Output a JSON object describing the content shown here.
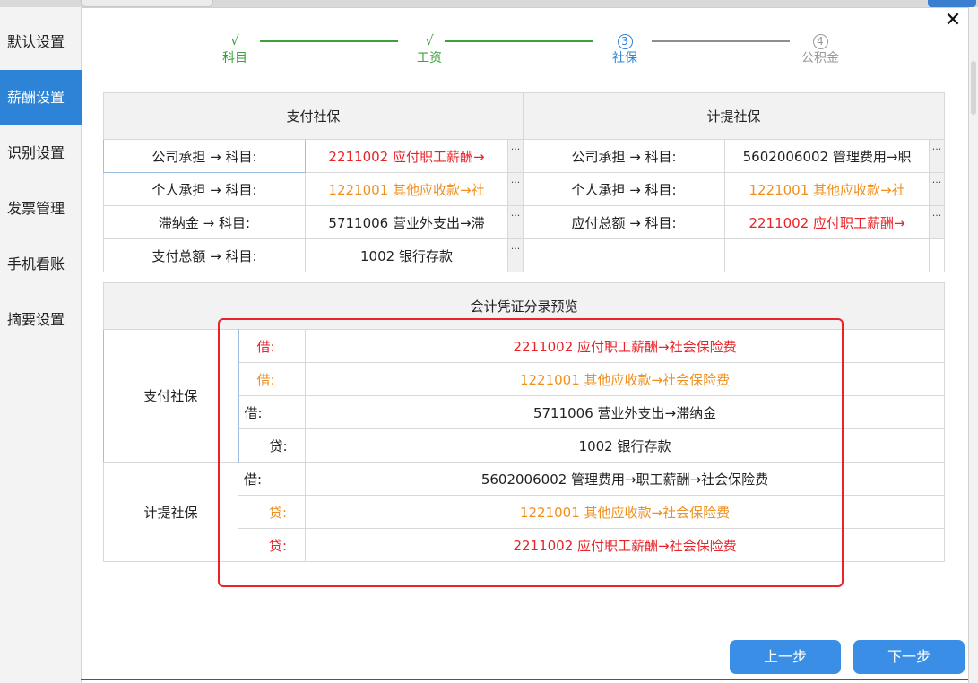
{
  "sidebar": {
    "items": [
      {
        "label": "默认设置"
      },
      {
        "label": "薪酬设置"
      },
      {
        "label": "识别设置"
      },
      {
        "label": "发票管理"
      },
      {
        "label": "手机看账"
      },
      {
        "label": "摘要设置"
      }
    ],
    "active_index": 1
  },
  "dialog": {
    "close_label": "✕"
  },
  "stepper": {
    "steps": [
      {
        "mark": "√",
        "label": "科目",
        "state": "done"
      },
      {
        "mark": "√",
        "label": "工资",
        "state": "done"
      },
      {
        "mark": "3",
        "label": "社保",
        "state": "current"
      },
      {
        "mark": "4",
        "label": "公积金",
        "state": "todo"
      }
    ]
  },
  "mapping": {
    "pay_header": "支付社保",
    "accrue_header": "计提社保",
    "pay_rows": [
      {
        "label": "公司承担 → 科目:",
        "value": "2211002 应付职工薪酬→",
        "color": "red"
      },
      {
        "label": "个人承担 → 科目:",
        "value": "1221001 其他应收款→社",
        "color": "orange"
      },
      {
        "label": "滞纳金 → 科目:",
        "value": "5711006 营业外支出→滞",
        "color": "black"
      },
      {
        "label": "支付总额 → 科目:",
        "value": "1002 银行存款",
        "color": "black"
      }
    ],
    "accrue_rows": [
      {
        "label": "公司承担 → 科目:",
        "value": "5602006002 管理费用→职",
        "color": "black"
      },
      {
        "label": "个人承担 → 科目:",
        "value": "1221001 其他应收款→社",
        "color": "orange"
      },
      {
        "label": "应付总额 → 科目:",
        "value": "2211002 应付职工薪酬→",
        "color": "red"
      }
    ],
    "dots": "···"
  },
  "preview": {
    "header": "会计凭证分录预览",
    "pay_group": "支付社保",
    "accrue_group": "计提社保",
    "entries": [
      {
        "dir": "借:",
        "text": "2211002 应付职工薪酬→社会保险费",
        "color": "red"
      },
      {
        "dir": "借:",
        "text": "1221001 其他应收款→社会保险费",
        "color": "orange"
      },
      {
        "dir": "借:",
        "text": "5711006 营业外支出→滞纳金",
        "color": "black"
      },
      {
        "dir": "贷:",
        "text": "1002 银行存款",
        "color": "black"
      },
      {
        "dir": "借:",
        "text": "5602006002 管理费用→职工薪酬→社会保险费",
        "color": "black"
      },
      {
        "dir": "贷:",
        "text": "1221001 其他应收款→社会保险费",
        "color": "orange"
      },
      {
        "dir": "贷:",
        "text": "2211002 应付职工薪酬→社会保险费",
        "color": "red"
      }
    ]
  },
  "buttons": {
    "prev": "上一步",
    "next": "下一步"
  },
  "colors": {
    "accent": "#2d83d6",
    "done": "#3ca03c",
    "red": "#e8242a",
    "orange": "#f0901e",
    "button": "#3a8ee6"
  }
}
